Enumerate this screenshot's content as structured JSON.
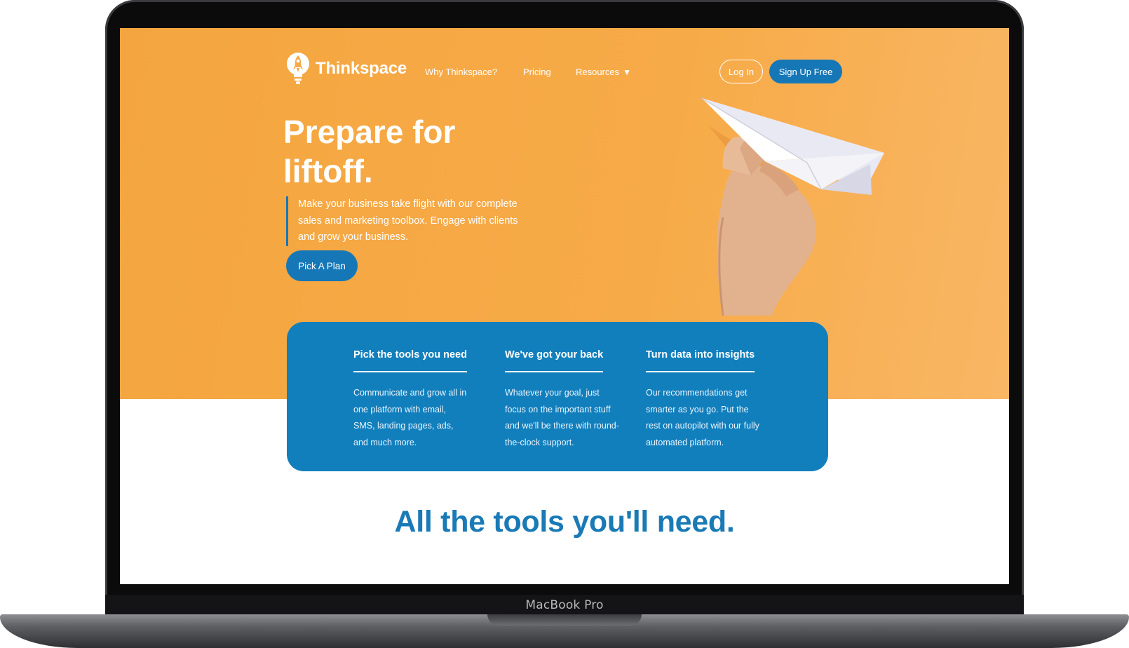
{
  "device": {
    "label": "MacBook Pro"
  },
  "header": {
    "brand": "Thinkspace",
    "nav": {
      "why": "Why Thinkspace?",
      "pricing": "Pricing",
      "resources": "Resources"
    },
    "login_label": "Log In",
    "signup_label": "Sign Up Free"
  },
  "hero": {
    "title": "Prepare for liftoff.",
    "copy": "Make your business take flight with our complete sales and marketing toolbox. Engage with clients and grow your business.",
    "cta_label": "Pick A Plan"
  },
  "features": [
    {
      "title": "Pick the tools you need",
      "text": "Communicate and grow all in one platform with email, SMS, landing pages, ads, and much more."
    },
    {
      "title": "We've got your back",
      "text": "Whatever your goal, just focus on the important stuff and we'll be there with round-the-clock support."
    },
    {
      "title": "Turn data into insights",
      "text": "Our recommendations get smarter as you go. Put the rest on autopilot with our fully automated platform."
    }
  ],
  "tools_section": {
    "title": "All the tools you'll need."
  },
  "colors": {
    "hero_orange": "#f7ab48",
    "accent_blue": "#1677b7",
    "card_blue": "#127fbd",
    "heading_blue": "#1a7ab6"
  },
  "icons": {
    "logo": "lightbulb-rocket-icon",
    "resources_caret": "caret-down-icon",
    "hero_image": "paper-airplane-hand-image"
  }
}
